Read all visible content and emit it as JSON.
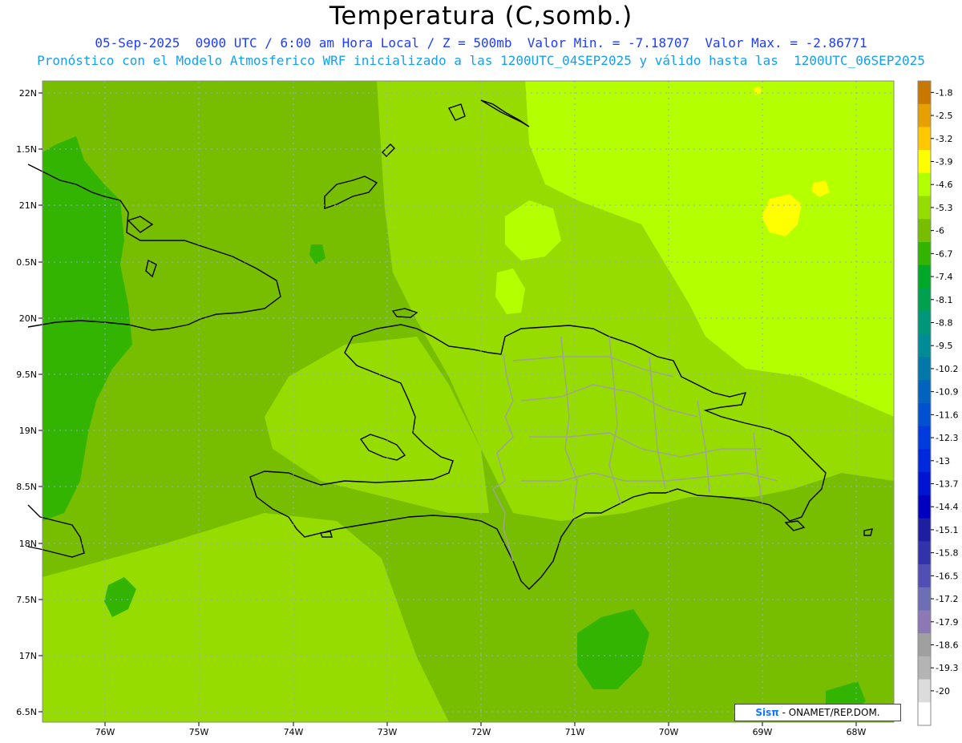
{
  "header": {
    "title": "Temperatura (C,somb.)",
    "line1": "05-Sep-2025  0900 UTC / 6:00 am Hora Local / Z = 500mb  Valor Min. = -7.18707  Valor Max. = -2.86771",
    "line2": "Pronóstico con el Modelo Atmosferico WRF inicializado a las 1200UTC_04SEP2025 y válido hasta las  1200UTC_06SEP2025"
  },
  "axes": {
    "lat_labels": [
      "22N",
      "1.5N",
      "21N",
      "0.5N",
      "20N",
      "9.5N",
      "19N",
      "8.5N",
      "18N",
      "7.5N",
      "17N",
      "6.5N"
    ],
    "lon_labels": [
      "76W",
      "75W",
      "74W",
      "73W",
      "72W",
      "71W",
      "70W",
      "69W",
      "68W"
    ]
  },
  "colorbar": {
    "labels": [
      "-1.8",
      "-2.5",
      "-3.2",
      "-3.9",
      "-4.6",
      "-5.3",
      "-6",
      "-6.7",
      "-7.4",
      "-8.1",
      "-8.8",
      "-9.5",
      "-10.2",
      "-10.9",
      "-11.6",
      "-12.3",
      "-13",
      "-13.7",
      "-14.4",
      "-15.1",
      "-15.8",
      "-16.5",
      "-17.2",
      "-17.9",
      "-18.6",
      "-19.3",
      "-20"
    ],
    "colors": [
      "#c87800",
      "#e6a000",
      "#ffc800",
      "#ffff00",
      "#b4ff00",
      "#96dc00",
      "#78be00",
      "#32b400",
      "#00aa28",
      "#00a050",
      "#00967a",
      "#008c96",
      "#0078aa",
      "#0064be",
      "#0050d2",
      "#003cdc",
      "#0028dc",
      "#0014d2",
      "#0000be",
      "#1e1ea0",
      "#3232aa",
      "#5050b4",
      "#6e6eb4",
      "#8c78b4",
      "#a0a0a0",
      "#b4b4b4",
      "#dcdcdc",
      "#ffffff"
    ]
  },
  "credit": {
    "logo": "Sisπ",
    "text": " - ONAMET/REP.DOM."
  },
  "palette": {
    "field_dark": "#78be00",
    "field_mid": "#96dc00",
    "field_light": "#b4ff00",
    "field_green": "#32b400",
    "field_yellow": "#ffff00",
    "coast": "#000000",
    "borders": "#a0a0a0"
  }
}
